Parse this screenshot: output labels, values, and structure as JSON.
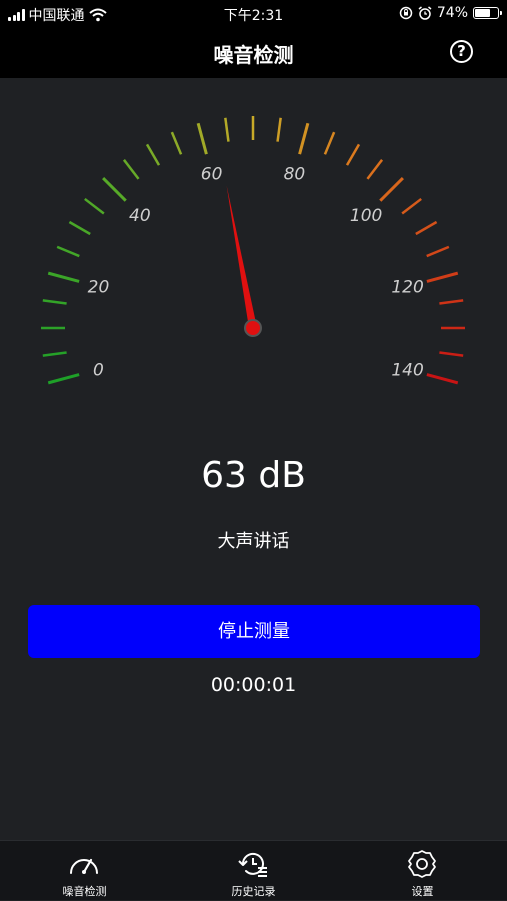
{
  "status_bar": {
    "carrier": "中国联通",
    "time": "下午2:31",
    "battery_percent": "74%",
    "battery_level": 0.74
  },
  "header": {
    "title": "噪音检测",
    "help_label": "?"
  },
  "gauge": {
    "min": 0,
    "max": 140,
    "labels": [
      "0",
      "20",
      "40",
      "60",
      "80",
      "100",
      "120",
      "140"
    ],
    "needle_value": 63
  },
  "reading": {
    "value": "63 dB",
    "description": "大声讲话"
  },
  "stop_button": {
    "label": "停止测量"
  },
  "timer": {
    "value": "00:00:01"
  },
  "tabs": [
    {
      "label": "噪音检测",
      "icon": "speedometer-icon",
      "active": true
    },
    {
      "label": "历史记录",
      "icon": "history-icon",
      "active": false
    },
    {
      "label": "设置",
      "icon": "gear-icon",
      "active": false
    }
  ],
  "colors": {
    "accent_button": "#0000fc",
    "needle": "#e01010",
    "background": "#1f2124"
  }
}
